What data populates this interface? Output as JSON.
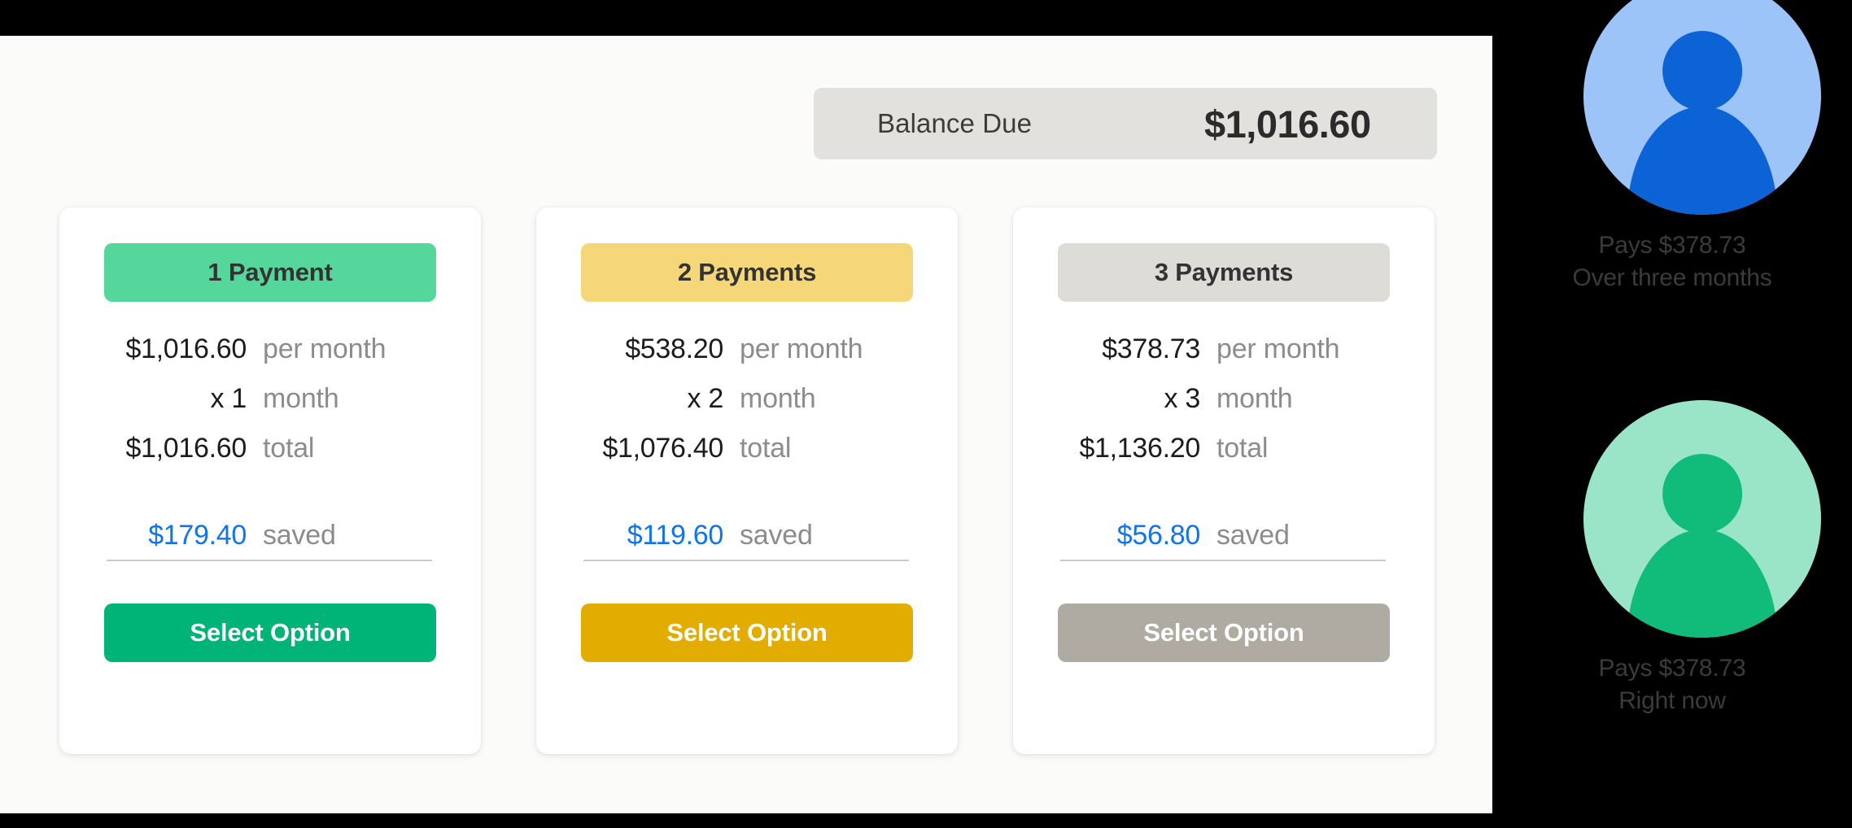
{
  "balance": {
    "label": "Balance Due",
    "amount": "$1,016.60"
  },
  "row_labels": {
    "per_month": "per month",
    "month": "month",
    "total": "total",
    "saved": "saved"
  },
  "cards": [
    {
      "header": "1 Payment",
      "per_month": "$1,016.60",
      "multiplier": "x 1",
      "total": "$1,016.60",
      "saved": "$179.40",
      "button": "Select Option",
      "header_bg": "#55d79b",
      "button_bg": "#00b377"
    },
    {
      "header": "2 Payments",
      "per_month": "$538.20",
      "multiplier": "x 2",
      "total": "$1,076.40",
      "saved": "$119.60",
      "button": "Select Option",
      "header_bg": "#f5d679",
      "button_bg": "#e3ac00"
    },
    {
      "header": "3 Payments",
      "per_month": "$378.73",
      "multiplier": "x 3",
      "total": "$1,136.20",
      "saved": "$56.80",
      "button": "Select Option",
      "header_bg": "#dedcd7",
      "button_bg": "#b0aba2"
    }
  ],
  "personas": [
    {
      "amount_line": "Pays $378.73",
      "timing_line": "Over three months",
      "circle_bg": "#9dc4f8",
      "figure": "#0b63d6"
    },
    {
      "amount_line": "Pays $378.73",
      "timing_line": "Right now",
      "circle_bg": "#9ae5c8",
      "figure": "#11bb79"
    }
  ],
  "colors": {
    "saved_accent": "#1473e6",
    "panel_bg": "#fbfbfa",
    "balance_bar_bg": "#e2e1dd"
  }
}
